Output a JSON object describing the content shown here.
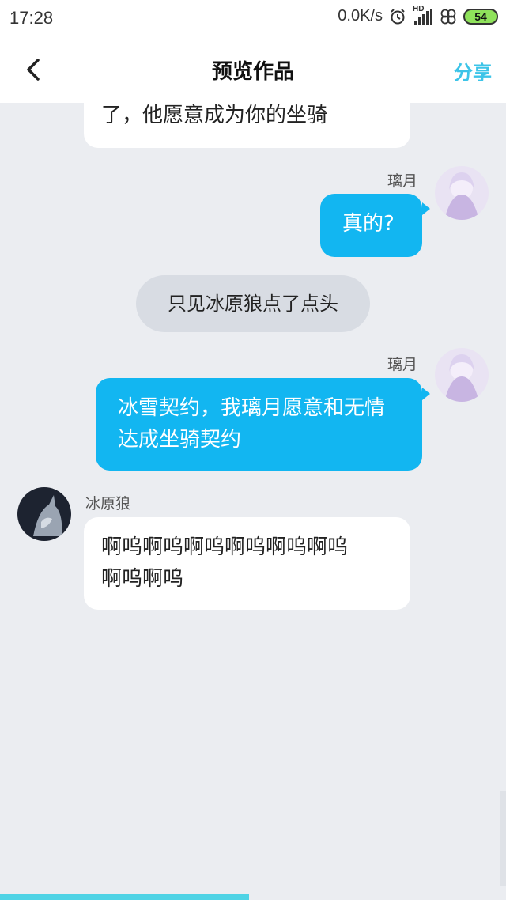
{
  "status_bar": {
    "time": "17:28",
    "network_speed": "0.0K/s",
    "hd_label": "HD",
    "battery_level": "54"
  },
  "header": {
    "title": "预览作品",
    "share_label": "分享"
  },
  "messages": [
    {
      "type": "white",
      "text": "了，他愿意成为你的坐骑"
    },
    {
      "type": "blue",
      "sender": "璃月",
      "text": "真的?"
    },
    {
      "type": "narration",
      "text": "只见冰原狼点了点头"
    },
    {
      "type": "blue",
      "sender": "璃月",
      "lines": [
        "冰雪契约，我璃月愿意和无情",
        "达成坐骑契约"
      ]
    },
    {
      "type": "white",
      "sender": "冰原狼",
      "lines": [
        "啊呜啊呜啊呜啊呜啊呜啊呜",
        "啊呜啊呜"
      ]
    }
  ],
  "colors": {
    "accent": "#3cc4e8",
    "bubble_blue": "#12b6f1",
    "background": "#ebedf1",
    "progress": "#4fd3e5"
  },
  "icons": {
    "back": "chevron-left-icon",
    "alarm": "alarm-icon",
    "signal": "signal-icon",
    "clover": "clover-icon"
  }
}
